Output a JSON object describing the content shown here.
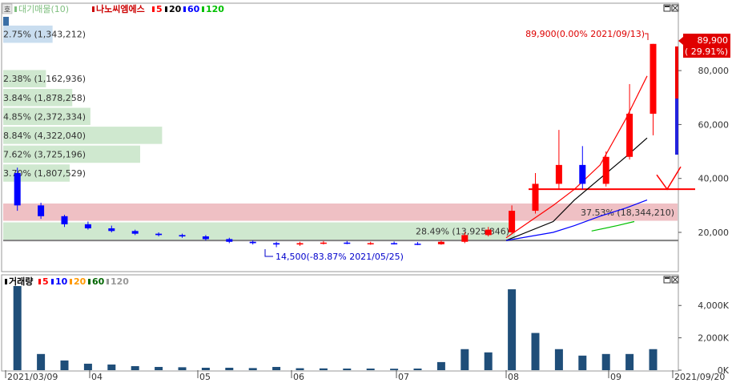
{
  "upper_legend": {
    "collapse_glyph": "호",
    "series": [
      {
        "label": "대기매물(10)",
        "color": "#7fbf7f",
        "bold": false
      },
      {
        "label": "나노씨엠에스",
        "color": "#cc0000",
        "bold": true
      },
      {
        "label": "5",
        "color": "#ff0000",
        "bold": true
      },
      {
        "label": "20",
        "color": "#000000",
        "bold": true
      },
      {
        "label": "60",
        "color": "#0000ff",
        "bold": true
      },
      {
        "label": "120",
        "color": "#00c000",
        "bold": true
      }
    ]
  },
  "lower_legend": {
    "series": [
      {
        "label": "거래량",
        "color": "#000000",
        "bold": true
      },
      {
        "label": "5",
        "color": "#ff0000",
        "bold": true
      },
      {
        "label": "10",
        "color": "#0000ff",
        "bold": true
      },
      {
        "label": "20",
        "color": "#ff9900",
        "bold": true
      },
      {
        "label": "60",
        "color": "#006600",
        "bold": true
      },
      {
        "label": "120",
        "color": "#999999",
        "bold": true
      }
    ]
  },
  "price_axis": {
    "ticks": [
      "80,000",
      "60,000",
      "40,000",
      "20,000"
    ]
  },
  "volume_axis": {
    "ticks": [
      "4,000K",
      "2,000K",
      "0K"
    ]
  },
  "x_axis": {
    "labels": [
      "2021/03/09",
      "04",
      "05",
      "06",
      "07",
      "08",
      "09",
      "2021/09/20"
    ]
  },
  "current_price_box": {
    "line1": "89,900",
    "line2": "( 29.91%)"
  },
  "high_annotation": "89,900(0.00% 2021/09/13)",
  "low_annotation": "14,500(-83.87% 2021/05/25)",
  "colors": {
    "up": "#ff0000",
    "down": "#0000ff",
    "support_line": "#ff0000",
    "base_line": "#808080"
  },
  "chart_data": [
    {
      "type": "candlestick",
      "title": "나노씨엠에스",
      "ylim": [
        0,
        95000
      ],
      "x_range": [
        "2021/03/09",
        "2021/09/20"
      ],
      "last_close": 89900,
      "change_pct": 29.91,
      "period_high": {
        "value": 89900,
        "date": "2021/09/13",
        "pct": 0.0
      },
      "period_low": {
        "value": 14500,
        "date": "2021/05/25",
        "pct": -83.87
      },
      "volume_profile": [
        {
          "label": "2.75% (1,343,212)",
          "price_low": 90000,
          "price_high": 97000
        },
        {
          "label": "2.38% (1,162,936)",
          "price_low": 73500,
          "price_high": 80500
        },
        {
          "label": "3.84% (1,878,258)",
          "price_low": 66500,
          "price_high": 73500
        },
        {
          "label": "4.85% (2,372,334)",
          "price_low": 59500,
          "price_high": 66500
        },
        {
          "label": "8.84% (4,322,040)",
          "price_low": 52500,
          "price_high": 59500
        },
        {
          "label": "7.62% (3,725,196)",
          "price_low": 45500,
          "price_high": 52500
        },
        {
          "label": "3.70% (1,807,529)",
          "price_low": 38500,
          "price_high": 45500
        },
        {
          "label": "37.53% (18,344,210)",
          "price_low": 24000,
          "price_high": 31000
        },
        {
          "label": "28.49% (13,925,846)",
          "price_low": 17000,
          "price_high": 24000
        }
      ],
      "support_level": 36000,
      "base_level": 17000,
      "months": [
        "03",
        "04",
        "05",
        "06",
        "07",
        "08",
        "09"
      ],
      "weekly_candles": [
        {
          "date": "2021/03/08",
          "open": 42000,
          "high": 44000,
          "low": 28000,
          "close": 30000
        },
        {
          "date": "2021/03/15",
          "open": 30000,
          "high": 31000,
          "low": 25000,
          "close": 26000
        },
        {
          "date": "2021/03/22",
          "open": 26000,
          "high": 26500,
          "low": 22000,
          "close": 23000
        },
        {
          "date": "2021/03/29",
          "open": 23000,
          "high": 24000,
          "low": 21000,
          "close": 21500
        },
        {
          "date": "2021/04/05",
          "open": 21500,
          "high": 22500,
          "low": 20000,
          "close": 20500
        },
        {
          "date": "2021/04/12",
          "open": 20500,
          "high": 21000,
          "low": 19000,
          "close": 19500
        },
        {
          "date": "2021/04/19",
          "open": 19500,
          "high": 20000,
          "low": 18500,
          "close": 19000
        },
        {
          "date": "2021/04/26",
          "open": 19000,
          "high": 19500,
          "low": 18000,
          "close": 18500
        },
        {
          "date": "2021/05/03",
          "open": 18500,
          "high": 19000,
          "low": 17000,
          "close": 17500
        },
        {
          "date": "2021/05/10",
          "open": 17500,
          "high": 18000,
          "low": 16000,
          "close": 16500
        },
        {
          "date": "2021/05/17",
          "open": 16500,
          "high": 17000,
          "low": 15500,
          "close": 16000
        },
        {
          "date": "2021/05/24",
          "open": 16000,
          "high": 16500,
          "low": 14500,
          "close": 15500
        },
        {
          "date": "2021/05/31",
          "open": 15500,
          "high": 16500,
          "low": 15000,
          "close": 16000
        },
        {
          "date": "2021/06/07",
          "open": 16000,
          "high": 16800,
          "low": 15500,
          "close": 16200
        },
        {
          "date": "2021/06/14",
          "open": 16200,
          "high": 16800,
          "low": 15600,
          "close": 15800
        },
        {
          "date": "2021/06/21",
          "open": 15800,
          "high": 16500,
          "low": 15400,
          "close": 16000
        },
        {
          "date": "2021/06/28",
          "open": 16000,
          "high": 16600,
          "low": 15500,
          "close": 15800
        },
        {
          "date": "2021/07/05",
          "open": 15800,
          "high": 16400,
          "low": 15300,
          "close": 15600
        },
        {
          "date": "2021/07/12",
          "open": 15600,
          "high": 17000,
          "low": 15400,
          "close": 16500
        },
        {
          "date": "2021/07/19",
          "open": 16500,
          "high": 20000,
          "low": 16000,
          "close": 19000
        },
        {
          "date": "2021/07/26",
          "open": 19000,
          "high": 22000,
          "low": 18500,
          "close": 21000
        },
        {
          "date": "2021/08/02",
          "open": 20000,
          "high": 30000,
          "low": 19500,
          "close": 28000
        },
        {
          "date": "2021/08/09",
          "open": 28000,
          "high": 42000,
          "low": 27000,
          "close": 38000
        },
        {
          "date": "2021/08/16",
          "open": 38000,
          "high": 58000,
          "low": 36000,
          "close": 45000
        },
        {
          "date": "2021/08/23",
          "open": 45000,
          "high": 52000,
          "low": 36000,
          "close": 38000
        },
        {
          "date": "2021/08/30",
          "open": 38000,
          "high": 50000,
          "low": 37000,
          "close": 48000
        },
        {
          "date": "2021/09/06",
          "open": 48000,
          "high": 75000,
          "low": 47000,
          "close": 64000
        },
        {
          "date": "2021/09/13",
          "open": 64000,
          "high": 89900,
          "low": 56000,
          "close": 89900
        }
      ],
      "ma5_visible": [
        [
          36000,
          18000
        ],
        [
          47000,
          30000
        ],
        [
          52000,
          36000
        ],
        [
          58000,
          45000
        ],
        [
          64000,
          62000
        ],
        [
          69000,
          78000
        ]
      ],
      "ma20_visible": [
        [
          36000,
          17000
        ],
        [
          47000,
          24000
        ],
        [
          52000,
          32000
        ],
        [
          58000,
          40000
        ],
        [
          64000,
          48000
        ],
        [
          69000,
          55000
        ]
      ],
      "ma60_visible": [
        [
          36000,
          17000
        ],
        [
          47000,
          20000
        ],
        [
          52000,
          22500
        ],
        [
          58000,
          26000
        ],
        [
          64000,
          29000
        ],
        [
          69000,
          32000
        ]
      ],
      "ma120_visible": [
        [
          56000,
          20500
        ],
        [
          62000,
          22500
        ],
        [
          66000,
          24000
        ]
      ]
    },
    {
      "type": "bar",
      "title": "거래량",
      "ylim": [
        0,
        5300
      ],
      "unit": "K",
      "categories": [
        "2021/03/08",
        "2021/03/15",
        "2021/03/22",
        "2021/03/29",
        "2021/04/05",
        "2021/04/12",
        "2021/04/19",
        "2021/04/26",
        "2021/05/03",
        "2021/05/10",
        "2021/05/17",
        "2021/05/24",
        "2021/05/31",
        "2021/06/07",
        "2021/06/14",
        "2021/06/21",
        "2021/06/28",
        "2021/07/05",
        "2021/07/12",
        "2021/07/19",
        "2021/07/26",
        "2021/08/02",
        "2021/08/09",
        "2021/08/16",
        "2021/08/23",
        "2021/08/30",
        "2021/09/06",
        "2021/09/13"
      ],
      "values": [
        5200,
        1000,
        600,
        400,
        350,
        250,
        200,
        180,
        150,
        150,
        130,
        200,
        120,
        110,
        100,
        100,
        90,
        100,
        500,
        1300,
        1100,
        5000,
        2300,
        1300,
        900,
        1000,
        1000,
        1300
      ]
    }
  ]
}
